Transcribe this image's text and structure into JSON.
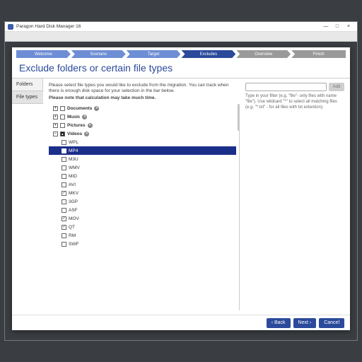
{
  "titlebar": {
    "title": "Paragon Hard Disk Manager 16"
  },
  "stepper": [
    {
      "label": "Welcome",
      "state": "done"
    },
    {
      "label": "Scenario",
      "state": "done"
    },
    {
      "label": "Target",
      "state": "done"
    },
    {
      "label": "Excludes",
      "state": "active"
    },
    {
      "label": "Overview",
      "state": "todo"
    },
    {
      "label": "Finish",
      "state": "todo"
    }
  ],
  "page_title": "Exclude folders or certain file types",
  "vtabs": {
    "folders": "Folders",
    "filetypes": "File types"
  },
  "hint": {
    "line1": "Please select file types you would like to exclude from the migration. You can track when there is enough disk space for your selection in the bar below.",
    "line2": "Please note that calculation may take much time."
  },
  "categories": [
    {
      "label": "Documents",
      "checked": false
    },
    {
      "label": "Music",
      "checked": false
    },
    {
      "label": "Pictures",
      "checked": false
    },
    {
      "label": "Videos",
      "checked": "partial",
      "expanded": true
    }
  ],
  "video_children": [
    {
      "label": "WPL",
      "checked": false,
      "selected": false
    },
    {
      "label": "MP4",
      "checked": true,
      "selected": true
    },
    {
      "label": "M3U",
      "checked": false,
      "selected": false
    },
    {
      "label": "WMV",
      "checked": false,
      "selected": false
    },
    {
      "label": "MID",
      "checked": false,
      "selected": false
    },
    {
      "label": "AVI",
      "checked": false,
      "selected": false
    },
    {
      "label": "MKV",
      "checked": true,
      "selected": false
    },
    {
      "label": "3GP",
      "checked": false,
      "selected": false
    },
    {
      "label": "ASF",
      "checked": false,
      "selected": false
    },
    {
      "label": "MOV",
      "checked": true,
      "selected": false
    },
    {
      "label": "QT",
      "checked": true,
      "selected": false
    },
    {
      "label": "RM",
      "checked": false,
      "selected": false
    },
    {
      "label": "SWF",
      "checked": false,
      "selected": false
    }
  ],
  "filter": {
    "placeholder": "",
    "add_label": "Add",
    "help": "Type in your filter (e.g. \"file\"- only files with name \"file\"). Use wildcard \"*\" to select all matching files (e.g. \"*.txt\" - for all files with txt extention)."
  },
  "footer": {
    "back": "‹ Back",
    "next": "Next ›",
    "cancel": "Cancel"
  }
}
